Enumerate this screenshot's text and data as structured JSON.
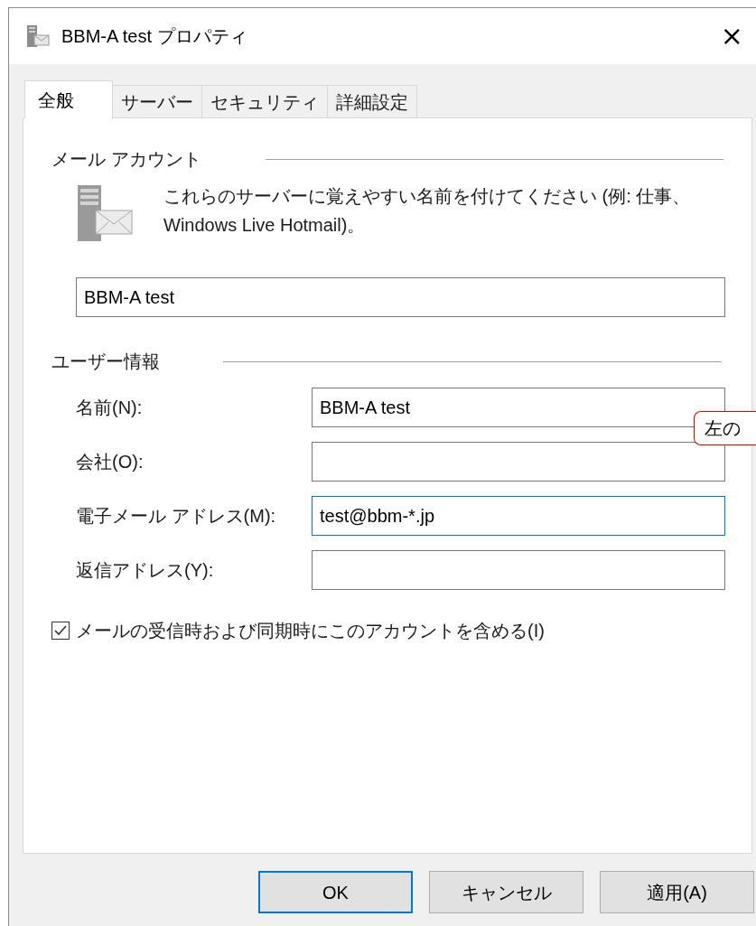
{
  "window": {
    "title": "BBM-A test プロパティ",
    "close": "×"
  },
  "tabs": [
    {
      "label": "全般",
      "selected": true
    },
    {
      "label": "サーバー",
      "selected": false
    },
    {
      "label": "セキュリティ",
      "selected": false
    },
    {
      "label": "詳細設定",
      "selected": false
    }
  ],
  "mail_account": {
    "heading": "メール アカウント",
    "description": "これらのサーバーに覚えやすい名前を付けてください (例: 仕事、Windows Live Hotmail)。",
    "account_name": "BBM-A test"
  },
  "user_info": {
    "heading": "ユーザー情報",
    "fields": [
      {
        "label": "名前(N):",
        "value": "BBM-A test",
        "focused": false
      },
      {
        "label": "会社(O):",
        "focused": false
      },
      {
        "label": "電子メール アドレス(M):",
        "value": "test@bbm-*.jp",
        "focused": true
      },
      {
        "label": "返信アドレス(Y):",
        "focused": false
      }
    ]
  },
  "include_account": {
    "label": "メールの受信時および同期時にこのアカウントを含める(I)",
    "checked": true
  },
  "buttons": [
    {
      "label": "OK",
      "default": true
    },
    {
      "label": "キャンセル",
      "default": false
    },
    {
      "label": "適用(A)",
      "default": false
    }
  ],
  "callout": {
    "text": "左の"
  }
}
